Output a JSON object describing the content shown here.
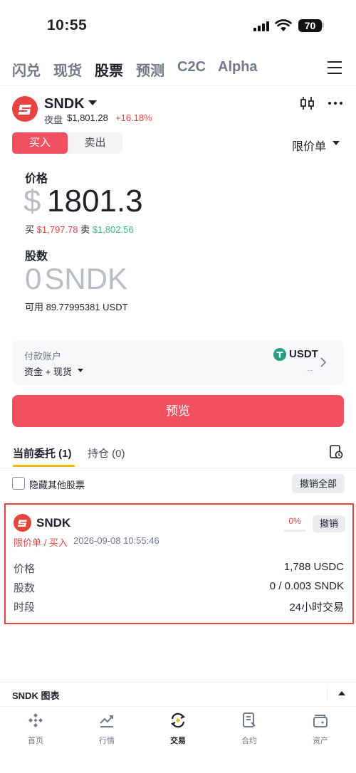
{
  "status_bar": {
    "time": "10:55",
    "battery": "70"
  },
  "top_nav": {
    "tabs": [
      {
        "label": "闪兑",
        "active": false
      },
      {
        "label": "现货",
        "active": false
      },
      {
        "label": "股票",
        "active": true
      },
      {
        "label": "预测",
        "active": false
      },
      {
        "label": "C2C",
        "active": false
      },
      {
        "label": "Alpha",
        "active": false
      }
    ]
  },
  "symbol": {
    "name": "SNDK",
    "session": "夜盘",
    "price": "$1,801.28",
    "change": "+16.18%"
  },
  "order_form": {
    "buy_label": "买入",
    "sell_label": "卖出",
    "order_type": "限价单",
    "price_label": "价格",
    "currency_symbol": "$",
    "price_value": "1801.3",
    "bid_label": "买",
    "bid_price": "$1,797.78",
    "ask_label": "卖",
    "ask_price": "$1,802.56",
    "qty_label": "股数",
    "qty_value": "0",
    "qty_unit": "SNDK",
    "available": "可用 89.77995381 USDT"
  },
  "payment": {
    "label": "付款账户",
    "account": "资金 + 现货",
    "currency": "USDT",
    "amount": "--"
  },
  "preview_label": "预览",
  "orders_tabs": {
    "open_label": "当前委托 (1)",
    "holdings_label": "持仓 (0)"
  },
  "hide_others_label": "隐藏其他股票",
  "cancel_all_label": "撤销全部",
  "order": {
    "symbol": "SNDK",
    "type": "限价单 / 买入",
    "time": "2026-09-08 10:55:46",
    "fill_percent": "0%",
    "fill_fraction": 0,
    "cancel_label": "撤销",
    "rows": [
      {
        "label": "价格",
        "value": "1,788 USDC"
      },
      {
        "label": "股数",
        "value": "0 / 0.003 SNDK"
      },
      {
        "label": "时段",
        "value": "24小时交易"
      }
    ]
  },
  "chart_drawer_label": "SNDK 图表",
  "bottom_nav": [
    {
      "label": "首页",
      "icon": "home-icon",
      "active": false
    },
    {
      "label": "行情",
      "icon": "markets-icon",
      "active": false
    },
    {
      "label": "交易",
      "icon": "trade-icon",
      "active": true
    },
    {
      "label": "合约",
      "icon": "futures-icon",
      "active": false
    },
    {
      "label": "资产",
      "icon": "wallet-icon",
      "active": false
    }
  ],
  "colors": {
    "buy": "#f0505f",
    "up": "#e8433e",
    "down": "#2ebd85",
    "accent": "#f0b90b"
  }
}
